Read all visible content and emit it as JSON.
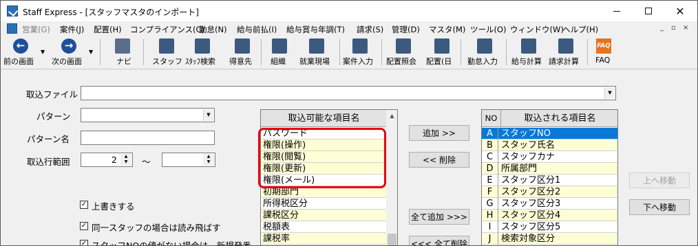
{
  "window": {
    "title": "Staff Express - [スタッフマスタのインポート]"
  },
  "menu": {
    "items": [
      "営業(G)",
      "案件(J)",
      "配置(H)",
      "コンプライアンス(C)",
      "勤怠(N)",
      "給与前払(I)",
      "給与賞与年調(T)",
      "請求(S)",
      "管理(D)",
      "マスタ(M)",
      "ツール(O)",
      "ウィンドウ(W)",
      "ヘルプ(H)"
    ],
    "mdi_buttons": [
      "_",
      "▫",
      "×"
    ]
  },
  "toolbar": {
    "prev_label": "前の画面",
    "next_label": "次の画面",
    "navi_label": "ナビ",
    "staff_label": "スタッフ",
    "staff_search_label": "ｽﾀｯﾌ検索",
    "client_label": "得意先",
    "org_label": "組織",
    "worksite_label": "就業現場",
    "case_input_label": "案件入力",
    "placement_inquiry_label": "配置照会",
    "placement_day_label": "配置(日",
    "attendance_input_label": "勤怠入力",
    "payroll_calc_label": "給与計算",
    "billing_calc_label": "請求計算",
    "faq_label": "FAQ"
  },
  "form": {
    "import_file_label": "取込ファイル",
    "import_file_value": "",
    "pattern_label": "パターン",
    "pattern_value": "",
    "pattern_name_label": "パターン名",
    "pattern_name_value": "",
    "row_range_label": "取込行範囲",
    "row_from": "2",
    "range_sep": "～",
    "row_to": ""
  },
  "available": {
    "header": "取込可能な項目名",
    "items": [
      "パスワード",
      "権限(操作)",
      "権限(閲覧)",
      "権限(更新)",
      "権限(メール)",
      "初期部門",
      "所得税区分",
      "課税区分",
      "税額表",
      "課税率"
    ]
  },
  "selected": {
    "header_no": "NO",
    "header_name": "取込される項目名",
    "items": [
      {
        "no": "A",
        "name": "スタッフNO"
      },
      {
        "no": "B",
        "name": "スタッフ氏名"
      },
      {
        "no": "C",
        "name": "スタッフカナ"
      },
      {
        "no": "D",
        "name": "所属部門"
      },
      {
        "no": "E",
        "name": "スタッフ区分1"
      },
      {
        "no": "F",
        "name": "スタッフ区分2"
      },
      {
        "no": "G",
        "name": "スタッフ区分3"
      },
      {
        "no": "H",
        "name": "スタッフ区分4"
      },
      {
        "no": "I",
        "name": "スタッフ区分5"
      },
      {
        "no": "J",
        "name": "検索対象区分"
      }
    ]
  },
  "buttons": {
    "add": "追加 >>",
    "remove": "<< 削除",
    "add_all": "全て追加 >>>",
    "remove_all": "<<< 全て削除",
    "move_up": "上へ移動",
    "move_down": "下へ移動"
  },
  "options": {
    "overwrite": "上書きする",
    "skip_same_staff": "同一スタッフの場合は読み飛ばす",
    "new_number": "スタッフNOの値がない場合は、新規発番"
  }
}
